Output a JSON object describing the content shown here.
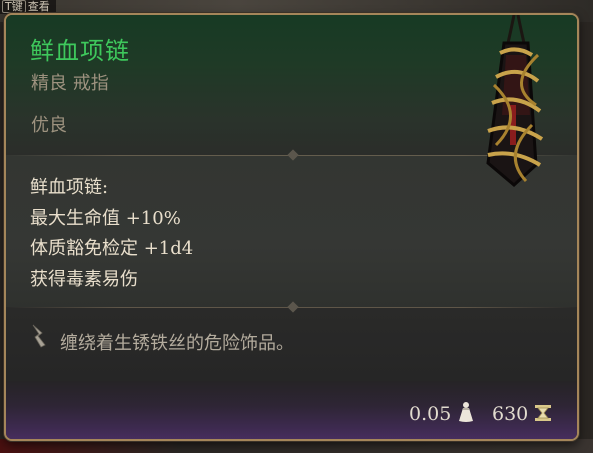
{
  "hotkey": {
    "key": "T键",
    "label": "查看"
  },
  "item": {
    "name": "鲜血项链",
    "subtitle": "精良 戒指",
    "rarity": "优良",
    "modifiers_title": "鲜血项链:",
    "modifiers": [
      "最大生命值 +10%",
      "体质豁免检定 +1d4",
      "获得毒素易伤"
    ],
    "flavor_text": "缠绕着生锈铁丝的危险饰品。",
    "weight": "0.05",
    "price": "630"
  },
  "icons": {
    "weight": "weight-bag-icon",
    "price": "gold-coin-icon",
    "flavor": "quill-icon",
    "item": "bloody-necklace-icon"
  },
  "colors": {
    "name": "#3ec85c",
    "border": "#a5865a",
    "rarity_text": "#9d927f",
    "modifier_text": "#e9dfcc"
  }
}
